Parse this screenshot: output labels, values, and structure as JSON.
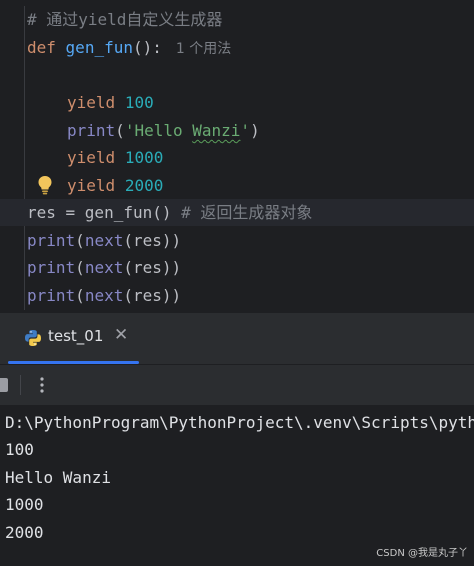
{
  "editor": {
    "comment_line": "# 通过yield自定义生成器",
    "def_keyword": "def",
    "func_name": "gen_fun",
    "def_tail": "():",
    "usage_hint": "1 个用法",
    "yield_kw": "yield",
    "y1_value": "100",
    "print_fn": "print",
    "open_paren": "(",
    "str_open": "'Hello ",
    "str_squiggled": "Wanzi",
    "str_close": "'",
    "close_paren": ")",
    "y2_value": "1000",
    "y3_value": "2000",
    "call_line_code": "res = gen_fun() ",
    "call_line_comment": "# 返回生成器对象",
    "next_fn": "next",
    "next_args": "(res))"
  },
  "run_panel": {
    "tab_label": "test_01",
    "tab_close": "✕",
    "more_glyph": "⋮",
    "output_lines": [
      "D:\\PythonProgram\\PythonProject\\.venv\\Scripts\\python.exe",
      "100",
      "Hello Wanzi",
      "1000",
      "2000"
    ]
  },
  "watermark": "CSDN @我是丸子丫",
  "colors": {
    "keyword": "#cf8e6d",
    "function": "#56a8f5",
    "number": "#2aacb8",
    "string": "#6aab73",
    "comment": "#7a7e85",
    "builtin": "#8888c6",
    "accent": "#3574f0"
  }
}
